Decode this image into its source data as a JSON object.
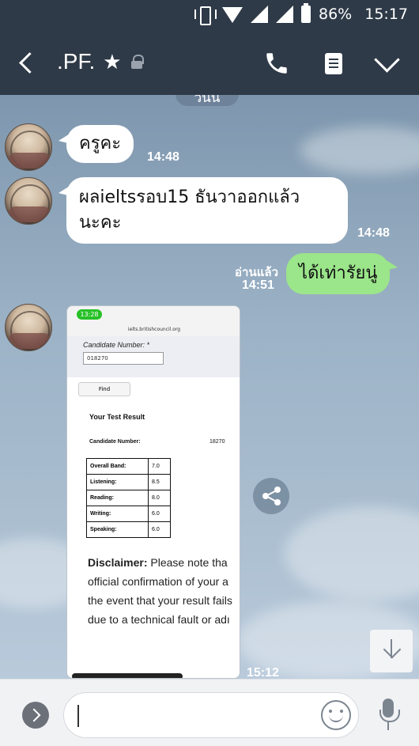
{
  "status_bar": {
    "battery": "86%",
    "clock": "15:17"
  },
  "header": {
    "title": ".PF.",
    "star": "★"
  },
  "date_separator": "วันนี้",
  "messages": [
    {
      "text": "ครูคะ",
      "time": "14:48"
    },
    {
      "text_line1": "ผลieltsรอบ15 ธันวาออกแล้ว",
      "text_line2": "นะคะ",
      "time": "14:48"
    },
    {
      "text": "ได้เท่ารัยนู่",
      "read": "อ่านแล้ว",
      "time": "14:51"
    },
    {
      "time": "15:12"
    }
  ],
  "screenshot": {
    "clock": "13:28",
    "url": "ielts.britishcouncil.org",
    "candidate_label": "Candidate Number: *",
    "candidate_input": "018270",
    "find_button": "Find",
    "result_heading": "Your Test Result",
    "candidate_row_label": "Candidate Number:",
    "candidate_row_value": "18270",
    "scores": [
      {
        "label": "Overall Band:",
        "value": "7.0"
      },
      {
        "label": "Listening:",
        "value": "8.5"
      },
      {
        "label": "Reading:",
        "value": "8.0"
      },
      {
        "label": "Writing:",
        "value": "6.0"
      },
      {
        "label": "Speaking:",
        "value": "6.0"
      }
    ],
    "disclaimer_bold": "Disclaimer:",
    "disclaimer_line1": " Please note tha",
    "disclaimer_line2": "official confirmation of your a",
    "disclaimer_line3": "the event that your result fails",
    "disclaimer_line4": "due to a technical fault or adı"
  },
  "colors": {
    "header_bg": "#2f3a48",
    "outgoing_bubble": "#9be58a",
    "incoming_bubble": "#ffffff"
  }
}
